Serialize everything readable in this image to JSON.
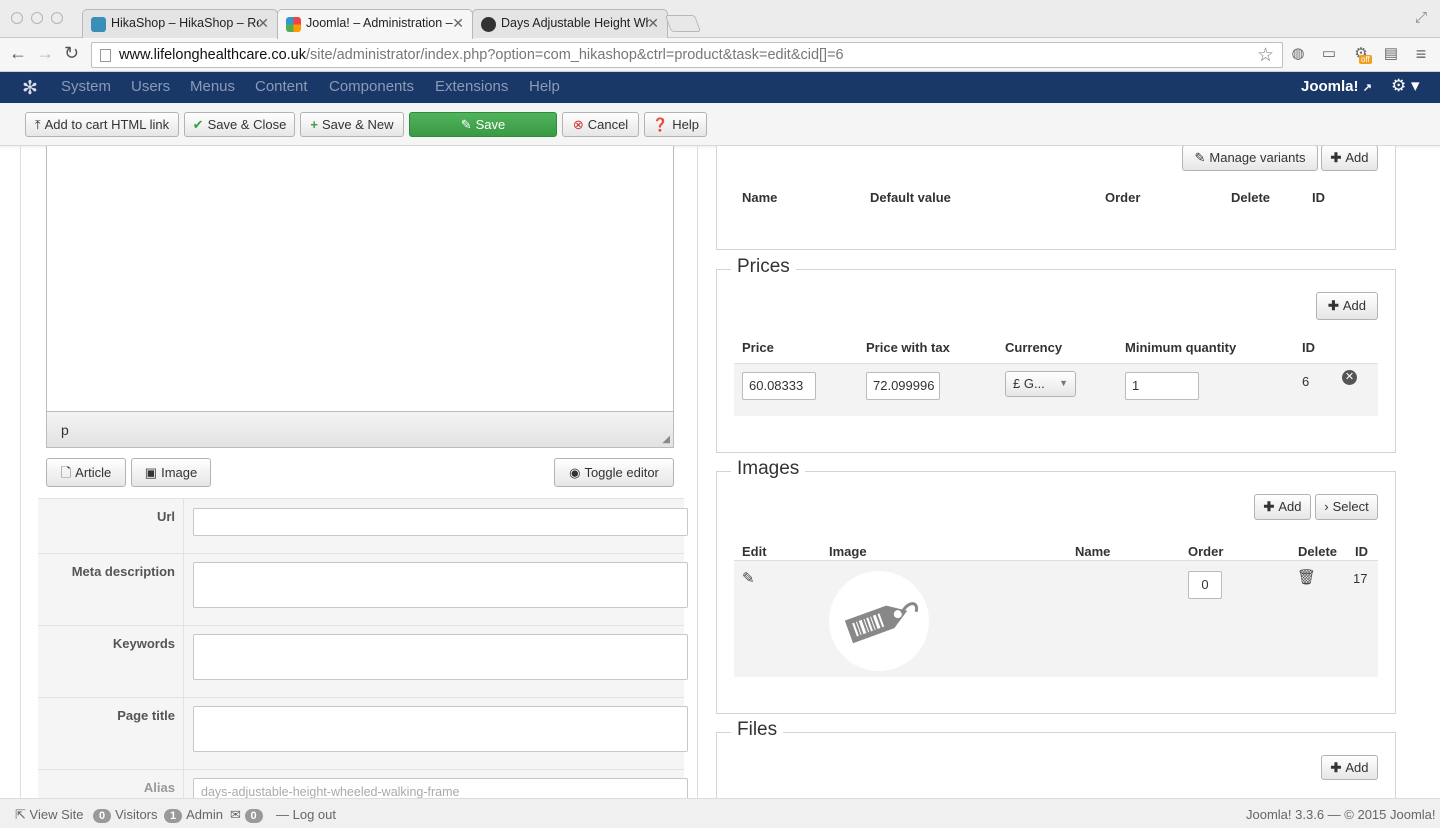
{
  "browser": {
    "tabs": [
      {
        "title": "HikaShop – HikaShop – Re"
      },
      {
        "title": "Joomla! – Administration –"
      },
      {
        "title": "Days Adjustable Height Wh"
      }
    ],
    "url_host": "www.lifelonghealthcare.co.uk",
    "url_path": "/site/administrator/index.php?option=com_hikashop&ctrl=product&task=edit&cid[]=6",
    "ext_badge": "off"
  },
  "admin_nav": {
    "menu": [
      "System",
      "Users",
      "Menus",
      "Content",
      "Components",
      "Extensions",
      "Help"
    ],
    "brand": "Joomla!"
  },
  "toolbar": {
    "add_to_cart": "Add to cart HTML link",
    "save_close": "Save & Close",
    "save_new": "Save & New",
    "save": "Save",
    "cancel": "Cancel",
    "help": "Help"
  },
  "editor": {
    "status_path": "p",
    "article_btn": "Article",
    "image_btn": "Image",
    "toggle_btn": "Toggle editor"
  },
  "meta_fields": {
    "url_label": "Url",
    "meta_description_label": "Meta description",
    "keywords_label": "Keywords",
    "page_title_label": "Page title",
    "alias_label": "Alias",
    "alias_value": "days-adjustable-height-wheeled-walking-frame"
  },
  "characteristics": {
    "manage_variants": "Manage variants",
    "add": "Add",
    "headers": [
      "Name",
      "Default value",
      "Order",
      "Delete",
      "ID"
    ]
  },
  "prices": {
    "legend": "Prices",
    "add": "Add",
    "headers": [
      "Price",
      "Price with tax",
      "Currency",
      "Minimum quantity",
      "ID"
    ],
    "row": {
      "price": "60.08333",
      "price_with_tax": "72.099996",
      "currency": "£ G...",
      "min_qty": "1",
      "id": "6"
    }
  },
  "images": {
    "legend": "Images",
    "add": "Add",
    "select": "Select",
    "headers": [
      "Edit",
      "Image",
      "Name",
      "Order",
      "Delete",
      "ID"
    ],
    "row": {
      "order": "0",
      "id": "17"
    }
  },
  "files": {
    "legend": "Files",
    "add": "Add"
  },
  "footer": {
    "view_site": "View Site",
    "visitors_count": "0",
    "visitors": "Visitors",
    "admin_count": "1",
    "admin": "Admin",
    "messages_count": "0",
    "logout": "Log out",
    "version": "Joomla! 3.3.6  —  © 2015 Joomla!"
  },
  "colors": {
    "nav_bg": "#1a3867",
    "save_green": "#46a850"
  }
}
